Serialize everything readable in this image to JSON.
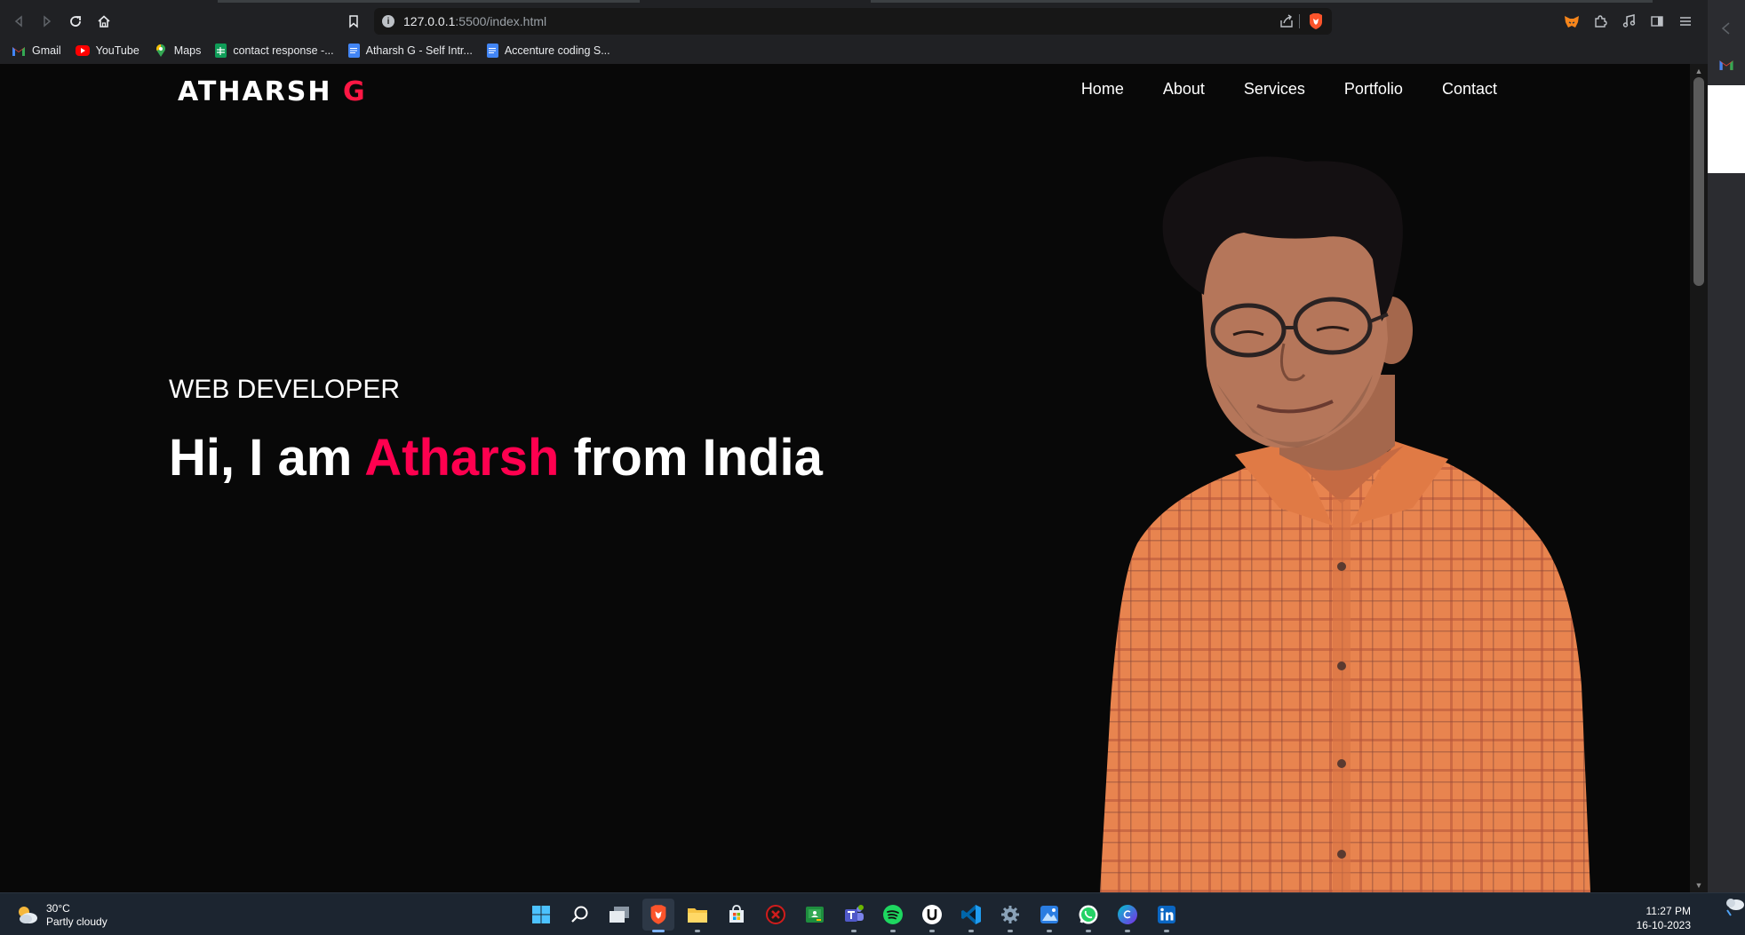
{
  "browser": {
    "url_host": "127.0.0.1",
    "url_path": ":5500/index.html",
    "bookmarks": [
      {
        "label": "Gmail",
        "icon": "gmail-icon",
        "color": "#ea4335"
      },
      {
        "label": "YouTube",
        "icon": "youtube-icon",
        "color": "#ff0000"
      },
      {
        "label": "Maps",
        "icon": "maps-icon",
        "color": "#34a853"
      },
      {
        "label": "contact response -...",
        "icon": "sheets-icon",
        "color": "#0f9d58"
      },
      {
        "label": "Atharsh G - Self Intr...",
        "icon": "docs-icon",
        "color": "#4285f4"
      },
      {
        "label": "Accenture coding S...",
        "icon": "docs-icon",
        "color": "#4285f4"
      }
    ]
  },
  "site": {
    "logo_main": "ATHARSH ",
    "logo_accent": "G",
    "nav": [
      "Home",
      "About",
      "Services",
      "Portfolio",
      "Contact"
    ],
    "subtitle": "WEB DEVELOPER",
    "headline_pre": "Hi, I am ",
    "headline_name": "Atharsh",
    "headline_post": " from India",
    "accent_color": "#ff004f",
    "logo_accent_color": "#ff1744"
  },
  "taskbar": {
    "temperature": "30°C",
    "weather": "Partly cloudy",
    "time": "11:27 PM",
    "date": "16-10-2023",
    "apps": [
      "start-icon",
      "search-icon",
      "task-view-icon",
      "brave-icon",
      "file-explorer-icon",
      "store-icon",
      "app-icon",
      "classroom-icon",
      "teams-icon",
      "spotify-icon",
      "u-app-icon",
      "vscode-icon",
      "settings-icon",
      "photos-icon",
      "whatsapp-icon",
      "canva-icon",
      "linkedin-icon"
    ]
  }
}
